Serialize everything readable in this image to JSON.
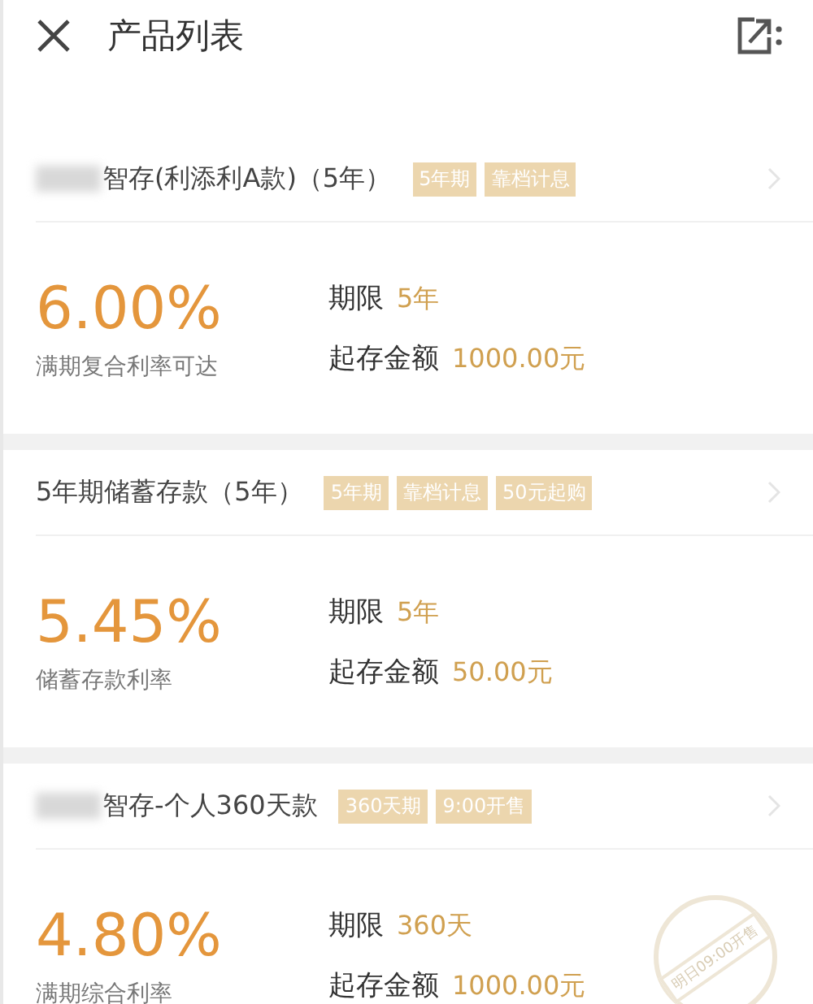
{
  "header": {
    "title": "产品列表"
  },
  "products": [
    {
      "name": "智存(利添利A款)（5年）",
      "name_blurred": true,
      "tags": [
        "5年期",
        "靠档计息"
      ],
      "rate": "6.00%",
      "rate_label": "满期复合利率可达",
      "term_label": "期限",
      "term": "5年",
      "min_label": "起存金额",
      "min": "1000.00元"
    },
    {
      "name": "5年期储蓄存款（5年）",
      "name_blurred": false,
      "tags": [
        "5年期",
        "靠档计息",
        "50元起购"
      ],
      "rate": "5.45%",
      "rate_label": "储蓄存款利率",
      "term_label": "期限",
      "term": "5年",
      "min_label": "起存金额",
      "min": "50.00元"
    },
    {
      "name": "智存-个人360天款",
      "name_blurred": true,
      "tags": [
        "360天期",
        "9:00开售"
      ],
      "rate": "4.80%",
      "rate_label": "满期综合利率",
      "term_label": "期限",
      "term": "360天",
      "min_label": "起存金额",
      "min": "1000.00元",
      "stamp": "明日09:00开售"
    }
  ]
}
